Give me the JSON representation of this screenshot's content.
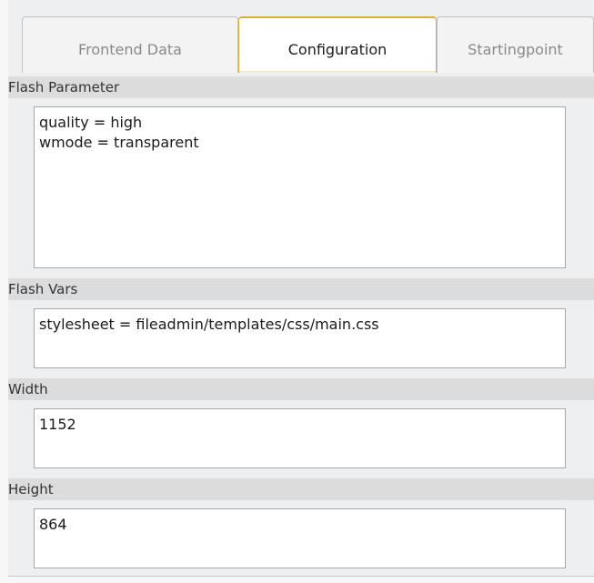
{
  "tabs": [
    {
      "label": "Frontend Data",
      "active": false
    },
    {
      "label": "Configuration",
      "active": true
    },
    {
      "label": "Startingpoint",
      "active": false
    }
  ],
  "sections": {
    "flash_parameter": {
      "label": "Flash Parameter",
      "value": "quality = high\nwmode = transparent"
    },
    "flash_vars": {
      "label": "Flash Vars",
      "value": "stylesheet = fileadmin/templates/css/main.css"
    },
    "width": {
      "label": "Width",
      "value": "1152"
    },
    "height": {
      "label": "Height",
      "value": "864"
    }
  },
  "colors": {
    "active_tab_border": "#d9b040",
    "section_header_bg": "#dcdcdc",
    "panel_bg": "#eeeff1"
  }
}
